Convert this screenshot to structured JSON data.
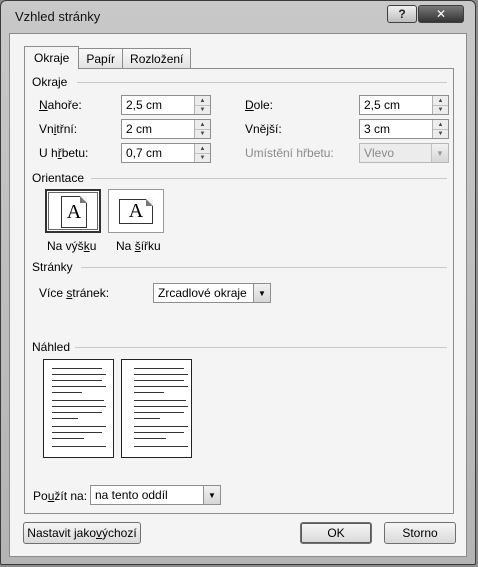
{
  "window": {
    "title": "Vzhled stránky",
    "help_label": "?",
    "close_label": "✕"
  },
  "tabs": [
    {
      "label": "Okraje",
      "active": true
    },
    {
      "label": "Papír",
      "active": false
    },
    {
      "label": "Rozložení",
      "active": false
    }
  ],
  "margins": {
    "section_title": "Okraje",
    "top": {
      "label_pre": "",
      "label_u": "N",
      "label_post": "ahoře:",
      "value": "2,5 cm"
    },
    "bottom": {
      "label_pre": "",
      "label_u": "D",
      "label_post": "ole:",
      "value": "2,5 cm"
    },
    "inner": {
      "label_pre": "Vn",
      "label_u": "i",
      "label_post": "třní:",
      "value": "2 cm"
    },
    "outer": {
      "label_pre": "Vně",
      "label_u": "j",
      "label_post": "ší:",
      "value": "3 cm"
    },
    "gutter": {
      "label_pre": "U h",
      "label_u": "ř",
      "label_post": "betu:",
      "value": "0,7 cm"
    },
    "gutter_position": {
      "label": "Umístění hřbetu:",
      "value": "Vlevo"
    }
  },
  "orientation": {
    "section_title": "Orientace",
    "glyph": "A",
    "portrait": {
      "label_pre": "Na výš",
      "label_u": "k",
      "label_post": "u"
    },
    "landscape": {
      "label_pre": "Na ",
      "label_u": "š",
      "label_post": "ířku"
    }
  },
  "pages": {
    "section_title": "Stránky",
    "multiple": {
      "label_pre": "Více ",
      "label_u": "s",
      "label_post": "tránek:",
      "value": "Zrcadlové okraje"
    }
  },
  "preview": {
    "section_title": "Náhled"
  },
  "apply_to": {
    "label_pre": "Po",
    "label_u": "u",
    "label_post": "žít na:",
    "value": "na tento oddíl"
  },
  "buttons": {
    "set_default": {
      "label_pre": "Nastavit jako ",
      "label_u": "v",
      "label_post": "ýchozí"
    },
    "ok": "OK",
    "cancel": "Storno"
  },
  "icons": {
    "spin_up": "▲",
    "spin_down": "▼",
    "dropdown": "▼"
  }
}
